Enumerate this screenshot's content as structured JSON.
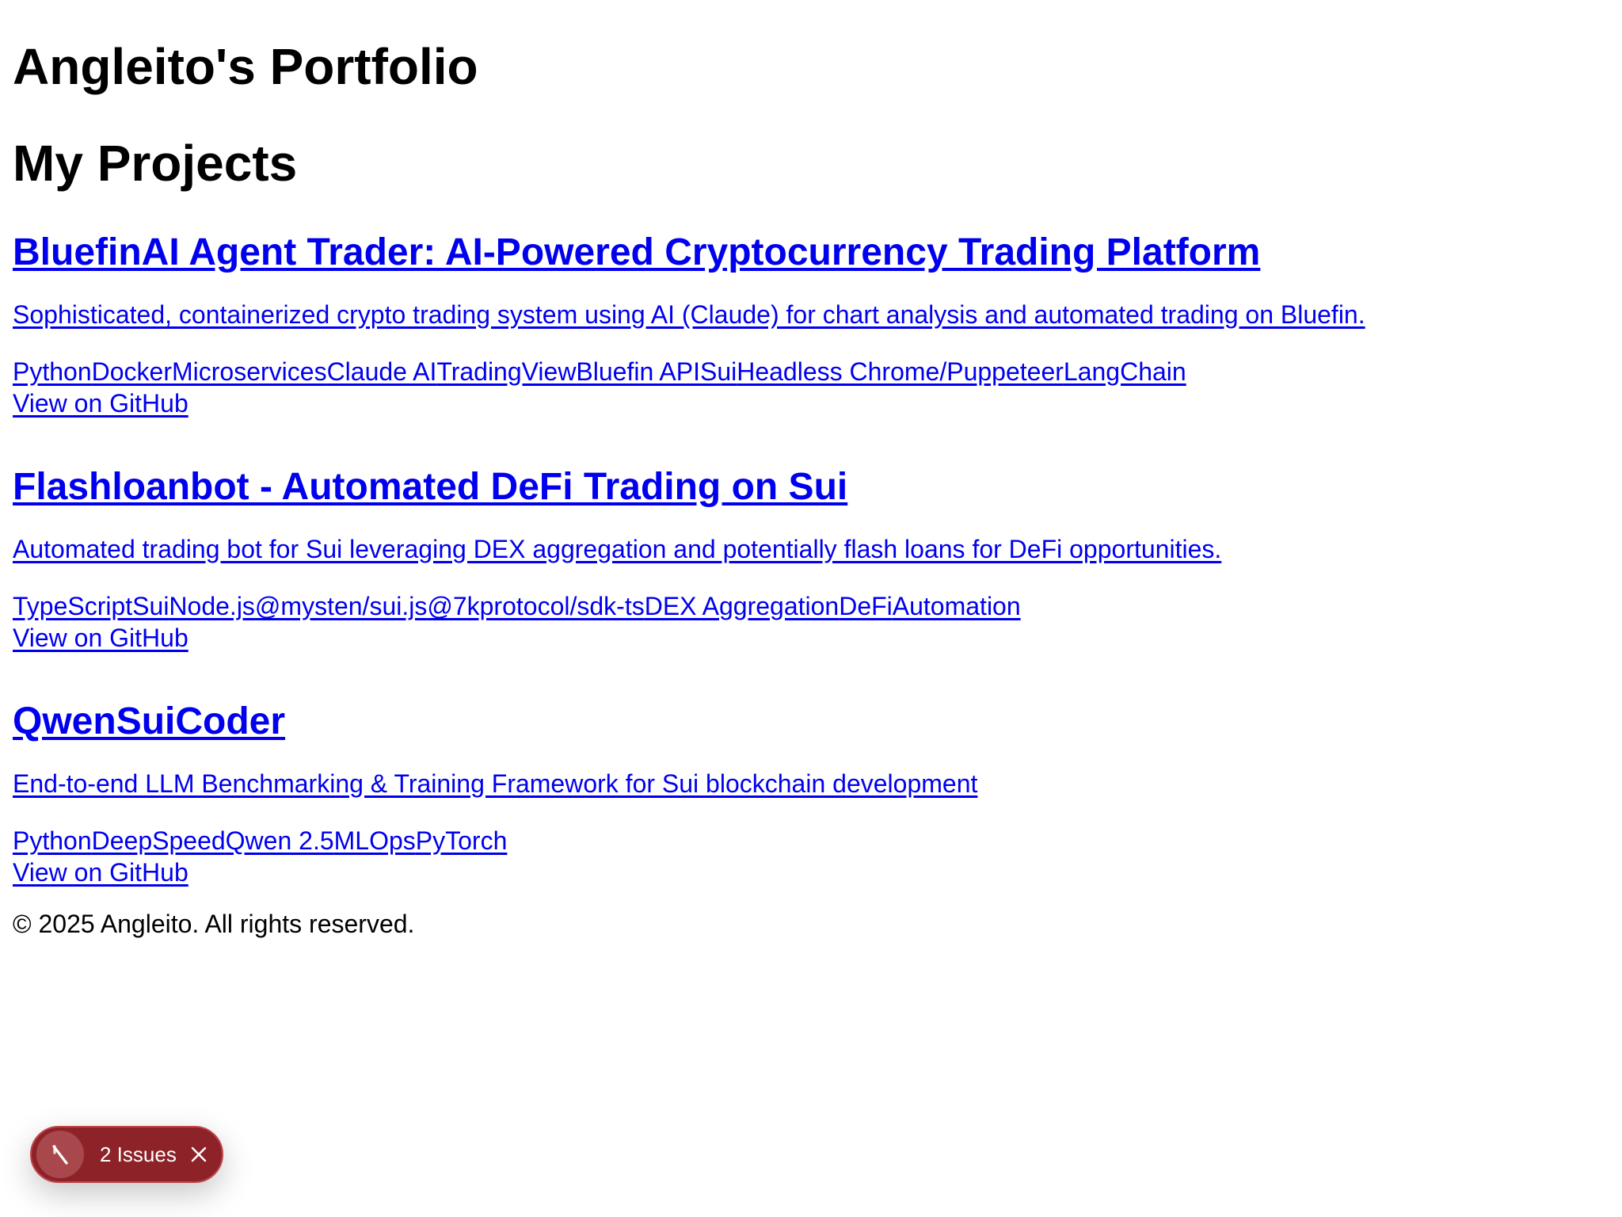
{
  "header": {
    "site_title": "Angleito's Portfolio"
  },
  "projects_section": {
    "title": "My Projects",
    "projects": [
      {
        "title": "BluefinAI Agent Trader: AI-Powered Cryptocurrency Trading Platform",
        "description": "Sophisticated, containerized crypto trading system using AI (Claude) for chart analysis and automated trading on Bluefin.",
        "tags": [
          "Python",
          "Docker",
          "Microservices",
          "Claude AI",
          "TradingView",
          "Bluefin API",
          "Sui",
          "Headless Chrome/Puppeteer",
          "LangChain"
        ],
        "link_label": "View on GitHub"
      },
      {
        "title": "Flashloanbot - Automated DeFi Trading on Sui",
        "description": "Automated trading bot for Sui leveraging DEX aggregation and potentially flash loans for DeFi opportunities.",
        "tags": [
          "TypeScript",
          "Sui",
          "Node.js",
          "@mysten/sui.js",
          "@7kprotocol/sdk-ts",
          "DEX Aggregation",
          "DeFi",
          "Automation"
        ],
        "link_label": "View on GitHub"
      },
      {
        "title": "QwenSuiCoder",
        "description": "End-to-end LLM Benchmarking & Training Framework for Sui blockchain development",
        "tags": [
          "Python",
          "DeepSpeed",
          "Qwen 2.5",
          "MLOps",
          "PyTorch"
        ],
        "link_label": "View on GitHub"
      }
    ]
  },
  "footer": {
    "copyright": "© 2025 Angleito. All rights reserved."
  },
  "dev_overlay": {
    "issues_label": "2 Issues",
    "logo_icon": "next-logo-icon",
    "close_icon": "close-icon",
    "colors": {
      "pill_background": "#8d2328",
      "pill_border": "#c0454b",
      "text": "#ffffff"
    }
  },
  "colors": {
    "link": "#0000ee",
    "text": "#000000",
    "background": "#ffffff"
  }
}
